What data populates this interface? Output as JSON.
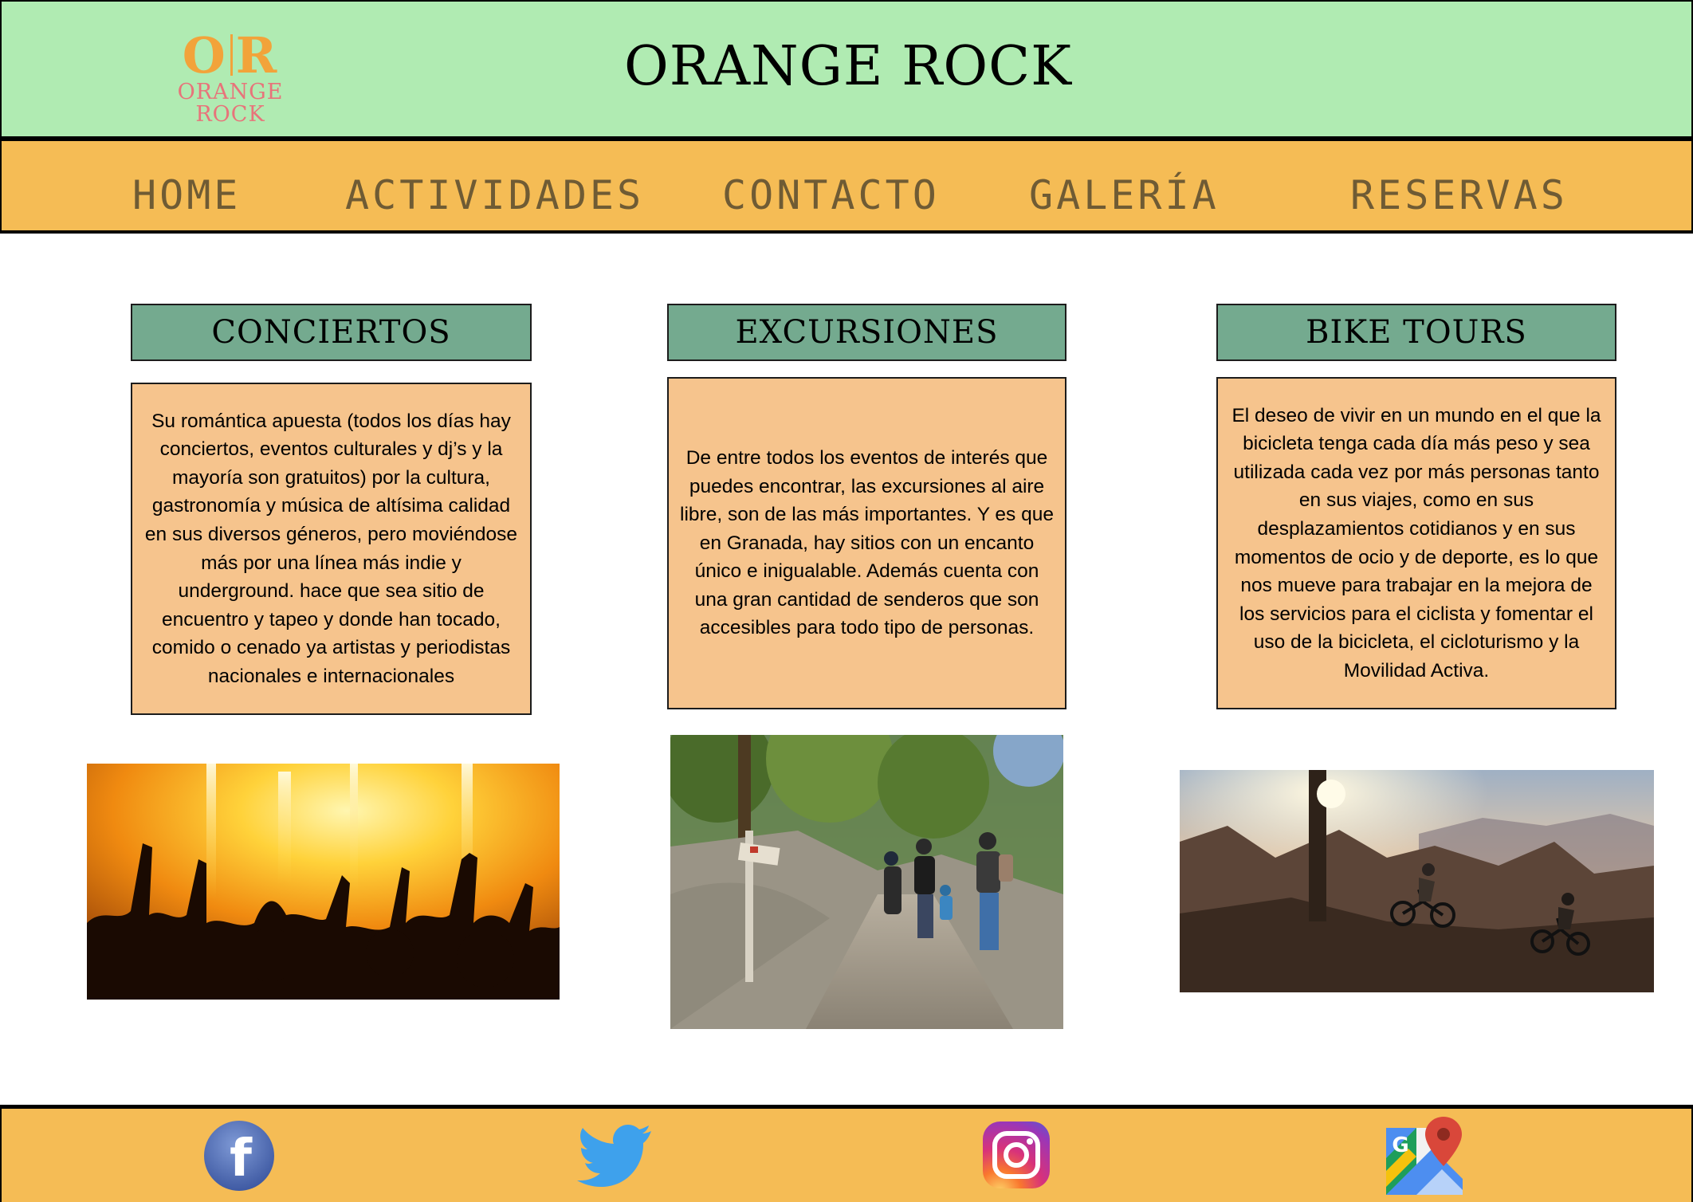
{
  "header": {
    "logo_mark_left": "O",
    "logo_mark_right": "R",
    "logo_name": "ORANGE ROCK",
    "title": "ORANGE ROCK"
  },
  "nav": {
    "items": [
      {
        "label": "HOME"
      },
      {
        "label": "ACTIVIDADES"
      },
      {
        "label": "CONTACTO"
      },
      {
        "label": "GALERÍA"
      },
      {
        "label": "RESERVAS"
      }
    ]
  },
  "cards": [
    {
      "title": "CONCIERTOS",
      "text": "Su romántica apuesta (todos los días hay conciertos, eventos culturales y dj’s y la mayoría son gratuitos) por la cultura, gastronomía y música de altísima calidad en sus diversos géneros, pero moviéndose más por una línea más indie y underground.  hace que sea sitio de encuentro y tapeo y donde han tocado, comido o cenado ya artistas y periodistas nacionales e internacionales",
      "image": "concert-crowd-photo"
    },
    {
      "title": "EXCURSIONES",
      "text": "De entre todos los eventos de interés  que puedes encontrar, las excursiones al aire libre, son de las más importantes.  Y es que en Granada, hay sitios con un encanto único e inigualable. Además cuenta con una gran cantidad de senderos que son accesibles para todo tipo de personas.",
      "image": "hiking-trail-photo"
    },
    {
      "title": "BIKE TOURS",
      "text": "El deseo de vivir en un mundo en el que la bicicleta tenga cada día más peso y sea utilizada cada vez por más personas tanto en sus viajes, como en sus desplazamientos cotidianos y en sus momentos de ocio y de deporte, es lo que nos mueve para trabajar en la mejora de los servicios para el ciclista y fomentar el uso de la bicicleta, el cicloturismo y la Movilidad Activa.",
      "image": "mountain-bike-photo"
    }
  ],
  "footer": {
    "social": [
      {
        "icon": "facebook-icon",
        "letter": "f"
      },
      {
        "icon": "twitter-icon"
      },
      {
        "icon": "instagram-icon"
      },
      {
        "icon": "google-maps-icon",
        "letter": "G"
      }
    ]
  },
  "colors": {
    "header_bg": "#b0ebb2",
    "nav_bg": "#f5bc55",
    "nav_text": "#6f5b34",
    "card_title_bg": "#74aa8f",
    "card_body_bg": "#f6c48d",
    "logo_orange": "#f2a33a",
    "logo_pink": "#e8737a"
  }
}
